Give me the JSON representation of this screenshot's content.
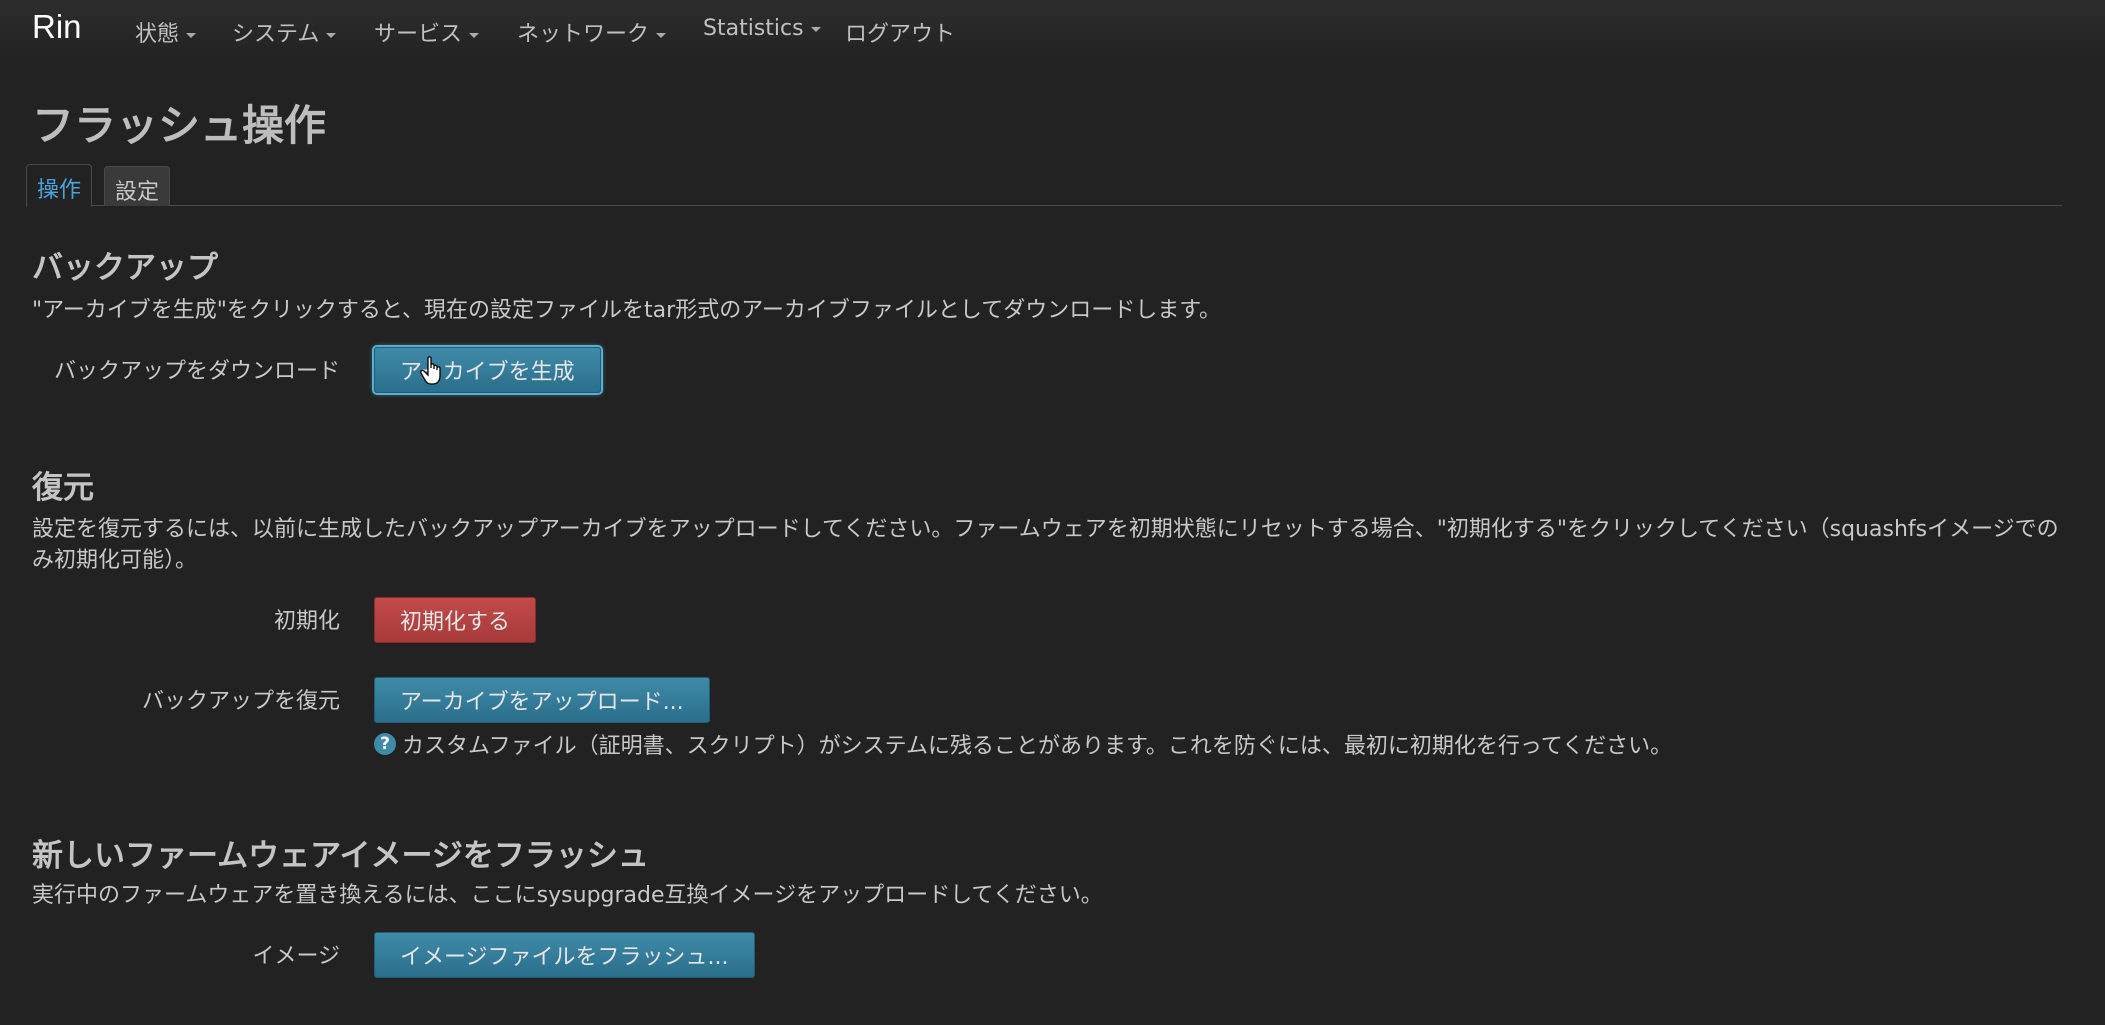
{
  "navbar": {
    "brand": "Rin",
    "items": [
      {
        "label": "状態"
      },
      {
        "label": "システム"
      },
      {
        "label": "サービス"
      },
      {
        "label": "ネットワーク"
      },
      {
        "label": "Statistics"
      },
      {
        "label": "ログアウト"
      }
    ]
  },
  "page": {
    "title": "フラッシュ操作",
    "tabs": [
      {
        "label": "操作",
        "active": true
      },
      {
        "label": "設定",
        "active": false
      }
    ]
  },
  "backup": {
    "title": "バックアップ",
    "description": "\"アーカイブを生成\"をクリックすると、現在の設定ファイルをtar形式のアーカイブファイルとしてダウンロードします。",
    "download_label": "バックアップをダウンロード",
    "generate_button": "アーカイブを生成"
  },
  "restore": {
    "title": "復元",
    "description": "設定を復元するには、以前に生成したバックアップアーカイブをアップロードしてください。ファームウェアを初期状態にリセットする場合、\"初期化する\"をクリックしてください（squashfsイメージでのみ初期化可能）。",
    "reset_label": "初期化",
    "reset_button": "初期化する",
    "restore_label": "バックアップを復元",
    "upload_button": "アーカイブをアップロード...",
    "help_text": "カスタムファイル（証明書、スクリプト）がシステムに残ることがあります。これを防ぐには、最初に初期化を行ってください。"
  },
  "flash": {
    "title": "新しいファームウェアイメージをフラッシュ",
    "description": "実行中のファームウェアを置き換えるには、ここにsysupgrade互換イメージをアップロードしてください。",
    "image_label": "イメージ",
    "flash_button": "イメージファイルをフラッシュ..."
  },
  "colors": {
    "background": "#222222",
    "primary_button": "#3f8aa8",
    "danger_button": "#c24a4a",
    "active_tab": "#4aa3df"
  },
  "icons": [
    "caret-down-icon",
    "help-icon",
    "hand-pointer-icon"
  ]
}
